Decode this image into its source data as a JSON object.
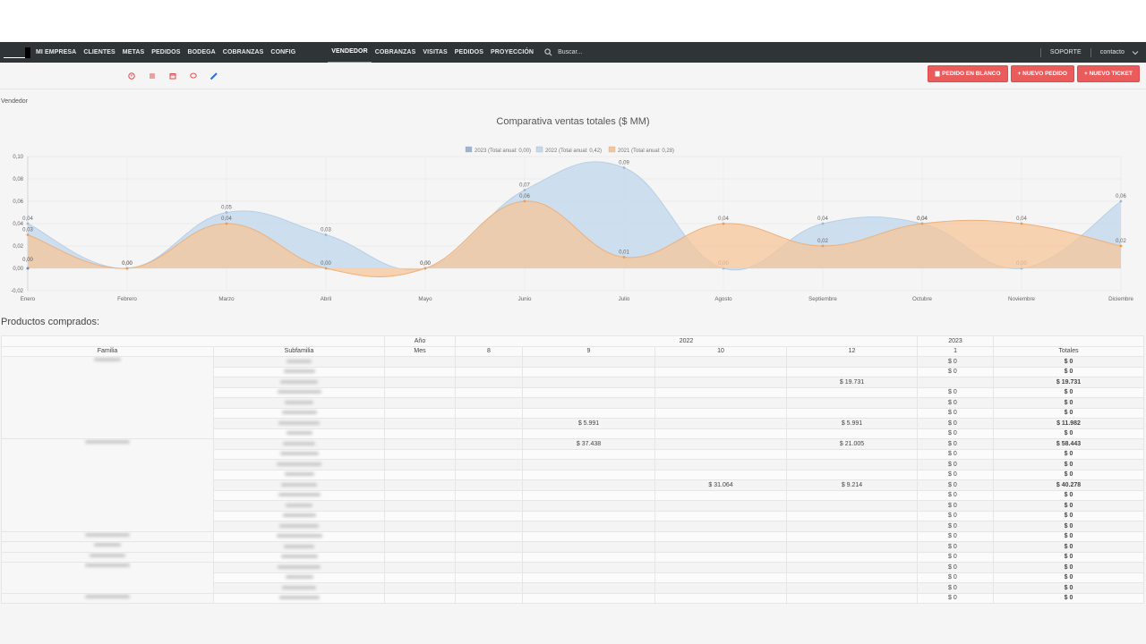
{
  "nav": {
    "left_items": [
      "MI EMPRESA",
      "CLIENTES",
      "METAS",
      "PEDIDOS",
      "BODEGA",
      "COBRANZAS",
      "CONFIG"
    ],
    "vendor_items": [
      "VENDEDOR",
      "COBRANZAS",
      "VISITAS",
      "PEDIDOS",
      "PROYECCIÓN"
    ],
    "active_item": "VENDEDOR",
    "search_placeholder": "Buscar...",
    "support": "SOPORTE",
    "user": "contacto"
  },
  "actions": {
    "blank_order": "PEDIDO EN BLANCO",
    "new_order": "+ NUEVO PEDIDO",
    "new_ticket": "+ NUEVO TICKET"
  },
  "vendor_label": "Vendedor",
  "chart_data": {
    "type": "area",
    "title": "Comparativa ventas totales ($ MM)",
    "categories": [
      "Enero",
      "Febrero",
      "Marzo",
      "Abril",
      "Mayo",
      "Junio",
      "Julio",
      "Agosto",
      "Septiembre",
      "Octubre",
      "Noviembre",
      "Diciembre"
    ],
    "ylim": [
      -0.02,
      0.1
    ],
    "yticks": [
      "0,10",
      "0,08",
      "0,06",
      "0,04",
      "0,02",
      "0,00",
      "-0,02"
    ],
    "legend_position": "top-center",
    "series": [
      {
        "name": "2023 (Total anual: 0,00)",
        "color": "#9fb3cc",
        "values": [
          0.0,
          null,
          null,
          null,
          null,
          null,
          null,
          null,
          null,
          null,
          null,
          null
        ],
        "labels": [
          "0,00"
        ]
      },
      {
        "name": "2022 (Total anual: 0,42)",
        "color": "#c5d9ec",
        "values": [
          0.04,
          0.0,
          0.05,
          0.03,
          0.0,
          0.07,
          0.09,
          0.0,
          0.04,
          0.04,
          0.0,
          0.06
        ],
        "labels": [
          "0,04",
          "0,00",
          "0,05",
          "0,03",
          "0,00",
          "0,07",
          "0,09",
          "0,00",
          "0,04",
          "0,04",
          "0,00",
          "0,06"
        ]
      },
      {
        "name": "2021 (Total anual: 0,28)",
        "color": "#f5c59a",
        "values": [
          0.03,
          0.0,
          0.04,
          0.0,
          0.0,
          0.06,
          0.01,
          0.04,
          0.02,
          0.04,
          0.04,
          0.02
        ],
        "labels": [
          "0,03",
          "0,00",
          "0,04",
          "0,00",
          "0,00",
          "0,06",
          "0,01",
          "0,04",
          "0,02",
          "0,04",
          "0,04",
          "0,02"
        ]
      }
    ]
  },
  "products": {
    "title": "Productos comprados:",
    "header_year_label": "Año",
    "header_month_label": "Mes",
    "col_family": "Familia",
    "col_subfamily": "Subfamilia",
    "years": [
      {
        "year": "2022",
        "span": 4
      },
      {
        "year": "2023",
        "span": 1
      }
    ],
    "months": [
      "8",
      "9",
      "10",
      "12",
      "1"
    ],
    "totals_label": "Totales",
    "rows": [
      {
        "cells": [
          "",
          "",
          "",
          "",
          "$ 0"
        ],
        "total": "$ 0"
      },
      {
        "cells": [
          "",
          "",
          "",
          "",
          "$ 0"
        ],
        "total": "$ 0"
      },
      {
        "cells": [
          "",
          "",
          "",
          "$ 19.731",
          ""
        ],
        "total": "$ 19.731"
      },
      {
        "cells": [
          "",
          "",
          "",
          "",
          "$ 0"
        ],
        "total": "$ 0"
      },
      {
        "cells": [
          "",
          "",
          "",
          "",
          "$ 0"
        ],
        "total": "$ 0"
      },
      {
        "cells": [
          "",
          "",
          "",
          "",
          "$ 0"
        ],
        "total": "$ 0"
      },
      {
        "cells": [
          "",
          "$ 5.991",
          "",
          "$ 5.991",
          "$ 0"
        ],
        "total": "$ 11.982"
      },
      {
        "cells": [
          "",
          "",
          "",
          "",
          "$ 0"
        ],
        "total": "$ 0"
      },
      {
        "cells": [
          "",
          "$ 37.438",
          "",
          "$ 21.005",
          "$ 0"
        ],
        "total": "$ 58.443"
      },
      {
        "cells": [
          "",
          "",
          "",
          "",
          "$ 0"
        ],
        "total": "$ 0"
      },
      {
        "cells": [
          "",
          "",
          "",
          "",
          "$ 0"
        ],
        "total": "$ 0"
      },
      {
        "cells": [
          "",
          "",
          "",
          "",
          "$ 0"
        ],
        "total": "$ 0"
      },
      {
        "cells": [
          "",
          "",
          "$ 31.064",
          "$ 9.214",
          "$ 0"
        ],
        "total": "$ 40.278"
      },
      {
        "cells": [
          "",
          "",
          "",
          "",
          "$ 0"
        ],
        "total": "$ 0"
      },
      {
        "cells": [
          "",
          "",
          "",
          "",
          "$ 0"
        ],
        "total": "$ 0"
      },
      {
        "cells": [
          "",
          "",
          "",
          "",
          "$ 0"
        ],
        "total": "$ 0"
      },
      {
        "cells": [
          "",
          "",
          "",
          "",
          "$ 0"
        ],
        "total": "$ 0"
      },
      {
        "cells": [
          "",
          "",
          "",
          "",
          "$ 0"
        ],
        "total": "$ 0"
      },
      {
        "cells": [
          "",
          "",
          "",
          "",
          "$ 0"
        ],
        "total": "$ 0"
      },
      {
        "cells": [
          "",
          "",
          "",
          "",
          "$ 0"
        ],
        "total": "$ 0"
      },
      {
        "cells": [
          "",
          "",
          "",
          "",
          "$ 0"
        ],
        "total": "$ 0"
      },
      {
        "cells": [
          "",
          "",
          "",
          "",
          "$ 0"
        ],
        "total": "$ 0"
      },
      {
        "cells": [
          "",
          "",
          "",
          "",
          "$ 0"
        ],
        "total": "$ 0"
      },
      {
        "cells": [
          "",
          "",
          "",
          "",
          "$ 0"
        ],
        "total": "$ 0"
      }
    ]
  }
}
